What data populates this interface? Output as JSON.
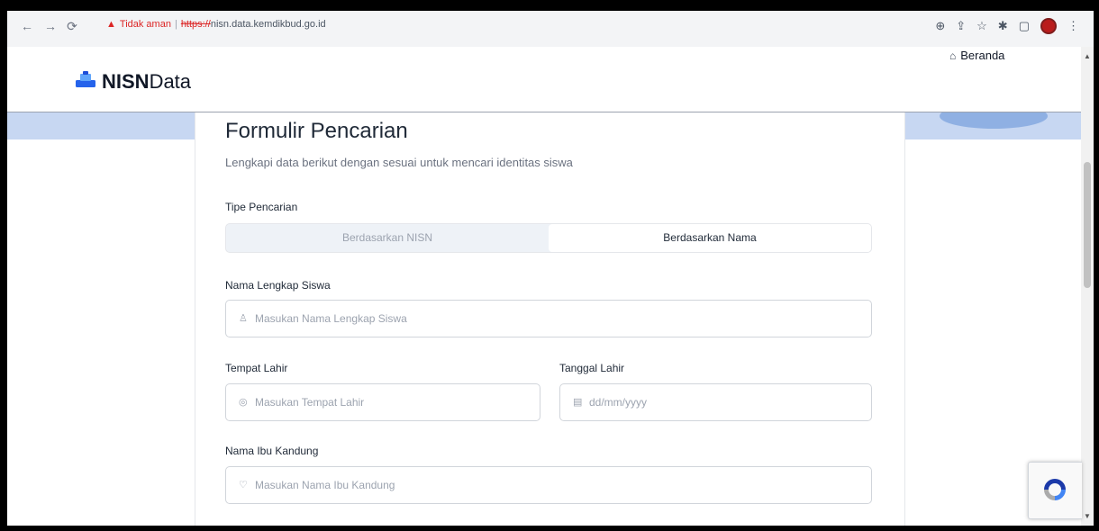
{
  "browser": {
    "security_label": "Tidak aman",
    "url_scheme": "https://",
    "url_host": "nisn.data.kemdikbud.go.id"
  },
  "site": {
    "brand_bold": "NISN",
    "brand_regular": "Data",
    "nav_home": "Beranda"
  },
  "form": {
    "title": "Formulir Pencarian",
    "subtitle": "Lengkapi data berikut dengan sesuai untuk mencari identitas siswa",
    "search_type_label": "Tipe Pencarian",
    "tabs": [
      {
        "label": "Berdasarkan NISN",
        "active": false
      },
      {
        "label": "Berdasarkan Nama",
        "active": true
      }
    ],
    "full_name": {
      "label": "Nama Lengkap Siswa",
      "placeholder": "Masukan Nama Lengkap Siswa"
    },
    "birth_place": {
      "label": "Tempat Lahir",
      "placeholder": "Masukan Tempat Lahir"
    },
    "birth_date": {
      "label": "Tanggal Lahir",
      "placeholder": "dd/mm/yyyy"
    },
    "mother_name": {
      "label": "Nama Ibu Kandung",
      "placeholder": "Masukan Nama Ibu Kandung"
    }
  },
  "icons": {
    "back": "back-arrow-icon",
    "forward": "forward-arrow-icon",
    "reload": "reload-icon",
    "warning": "warning-icon",
    "home": "home-icon",
    "user": "user-icon",
    "location": "location-pin-icon",
    "calendar": "calendar-icon",
    "heart": "heart-icon",
    "recaptcha": "recaptcha-icon"
  },
  "colors": {
    "accent_band": "#c7d7f2",
    "logo_blue": "#2563eb",
    "warning_red": "#dc2626",
    "active_tab_bg": "#ffffff",
    "inactive_tab_bg": "#eef2f7"
  }
}
